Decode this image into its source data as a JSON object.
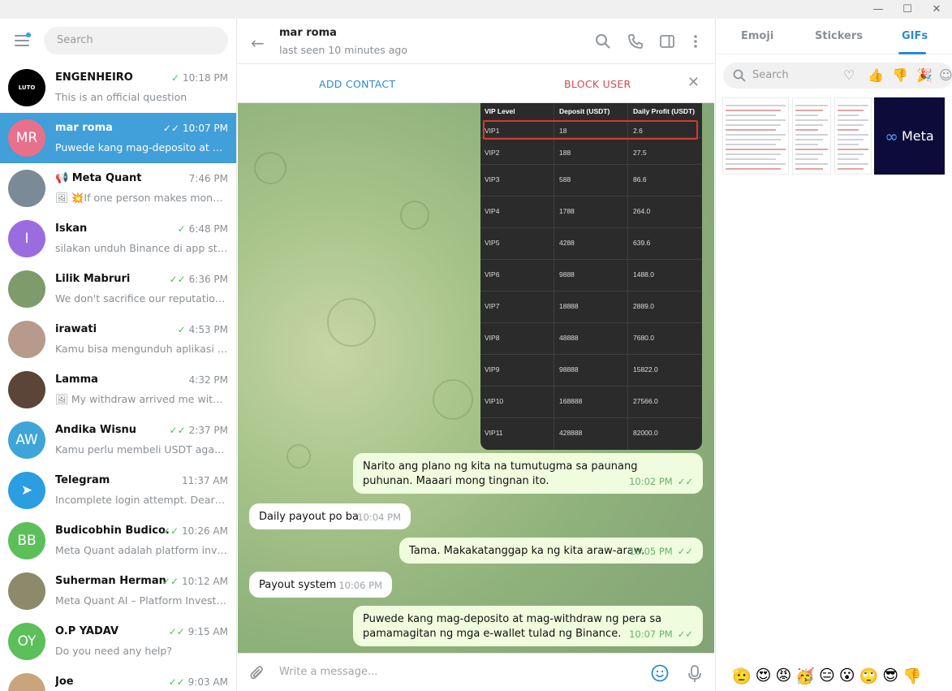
{
  "window": {
    "minimize": "—",
    "maximize": "☐",
    "close": "✕"
  },
  "sidebar": {
    "search_placeholder": "Search",
    "chats": [
      {
        "name": "ENGENHEIRO",
        "time": "10:18 PM",
        "ticks": "✓",
        "preview": "This is an official question",
        "avatar_text": "LUTO",
        "avatar_color": "#000000"
      },
      {
        "name": "mar roma",
        "time": "10:07 PM",
        "ticks": "✓✓",
        "preview": "Puwede kang mag-deposito at ma...",
        "avatar_text": "MR",
        "avatar_color": "#e8708a",
        "active": true
      },
      {
        "name": "📢 Meta Quant",
        "time": "7:46 PM",
        "ticks": "",
        "preview": "🖼 💥If one person makes mone...",
        "avatar_text": "",
        "avatar_color": "#7a8a96"
      },
      {
        "name": "Iskan",
        "time": "6:48 PM",
        "ticks": "✓",
        "preview": "silakan unduh Binance di app stor...",
        "avatar_text": "I",
        "avatar_color": "#9b6ce0"
      },
      {
        "name": "Lilik Mabruri",
        "time": "6:36 PM",
        "ticks": "✓✓",
        "preview": "We don't sacrifice our reputation j...",
        "avatar_text": "",
        "avatar_color": "#7e9b6b"
      },
      {
        "name": "irawati",
        "time": "4:53 PM",
        "ticks": "✓",
        "preview": "Kamu bisa mengunduh aplikasi se...",
        "avatar_text": "",
        "avatar_color": "#b79a8c"
      },
      {
        "name": "Lamma",
        "time": "4:32 PM",
        "ticks": "",
        "preview": "🖼 My withdraw arrived me withi...",
        "avatar_text": "",
        "avatar_color": "#5a4538"
      },
      {
        "name": "Andika Wisnu",
        "time": "2:37 PM",
        "ticks": "✓✓",
        "preview": "Kamu perlu membeli USDT agar bi...",
        "avatar_text": "AW",
        "avatar_color": "#3ea5d9"
      },
      {
        "name": "Telegram",
        "time": "11:37 AM",
        "ticks": "",
        "preview": "Incomplete login attempt. Dear M...",
        "avatar_text": "➤",
        "avatar_color": "#2a9ee0"
      },
      {
        "name": "Budicobhin Budico...",
        "time": "10:26 AM",
        "ticks": "✓✓",
        "preview": "Meta Quant adalah platform inves...",
        "avatar_text": "BB",
        "avatar_color": "#5cbf5a"
      },
      {
        "name": "Suherman Herman",
        "time": "10:12 AM",
        "ticks": "✓✓",
        "preview": "Meta Quant AI – Platform Investas...",
        "avatar_text": "",
        "avatar_color": "#8c8a6a"
      },
      {
        "name": "O.P YADAV",
        "time": "9:15 AM",
        "ticks": "✓✓",
        "preview": "Do you need any help?",
        "avatar_text": "OY",
        "avatar_color": "#5cbf5a"
      },
      {
        "name": "Joe",
        "time": "9:03 AM",
        "ticks": "✓✓",
        "preview": "",
        "avatar_text": "",
        "avatar_color": "#c9a57c"
      }
    ]
  },
  "chat": {
    "peer_name": "mar roma",
    "peer_status": "last seen 10 minutes ago",
    "add_contact": "ADD CONTACT",
    "block_user": "BLOCK USER",
    "composer_placeholder": "Write a message...",
    "vip_table": {
      "headers": [
        "VIP Level",
        "Deposit (USDT)",
        "Daily Profit (USDT)"
      ],
      "rows": [
        [
          "VIP1",
          "18",
          "2.6"
        ],
        [
          "VIP2",
          "188",
          "27.5"
        ],
        [
          "VIP3",
          "588",
          "86.6"
        ],
        [
          "VIP4",
          "1788",
          "264.0"
        ],
        [
          "VIP5",
          "4288",
          "639.6"
        ],
        [
          "VIP6",
          "9888",
          "1488.0"
        ],
        [
          "VIP7",
          "18888",
          "2889.0"
        ],
        [
          "VIP8",
          "48888",
          "7680.0"
        ],
        [
          "VIP9",
          "98888",
          "15822.0"
        ],
        [
          "VIP10",
          "168888",
          "27566.0"
        ],
        [
          "VIP11",
          "428888",
          "82000.0"
        ]
      ]
    },
    "messages": [
      {
        "dir": "out",
        "text": "Narito ang plano ng kita na tumutugma sa paunang puhunan. Maaari mong tingnan ito.",
        "time": "10:02 PM"
      },
      {
        "dir": "in",
        "text": "Daily payout po ba",
        "time": "10:04 PM"
      },
      {
        "dir": "out",
        "text": "Tama. Makakatanggap ka ng kita araw-araw.",
        "time": "10:05 PM"
      },
      {
        "dir": "in",
        "text": "Payout system",
        "time": "10:06 PM"
      },
      {
        "dir": "out",
        "text": "Puwede kang mag-deposito at mag-withdraw ng pera sa pamamagitan ng mga e-wallet tulad ng Binance.",
        "time": "10:07 PM"
      }
    ]
  },
  "panel": {
    "tabs": [
      "Emoji",
      "Stickers",
      "GIFs"
    ],
    "active_tab": "GIFs",
    "search_placeholder": "Search",
    "meta_gif_label": "Meta",
    "emoji_bar": [
      "🫡",
      "😍",
      "😡",
      "🥳",
      "😑",
      "😮",
      "🙄",
      "😎",
      "👎"
    ]
  },
  "colors": {
    "accent": "#419fd9",
    "link": "#2b8ad3",
    "danger": "#d14e4e",
    "outgoing_bubble": "#effdde",
    "check": "#4fbd5c"
  }
}
